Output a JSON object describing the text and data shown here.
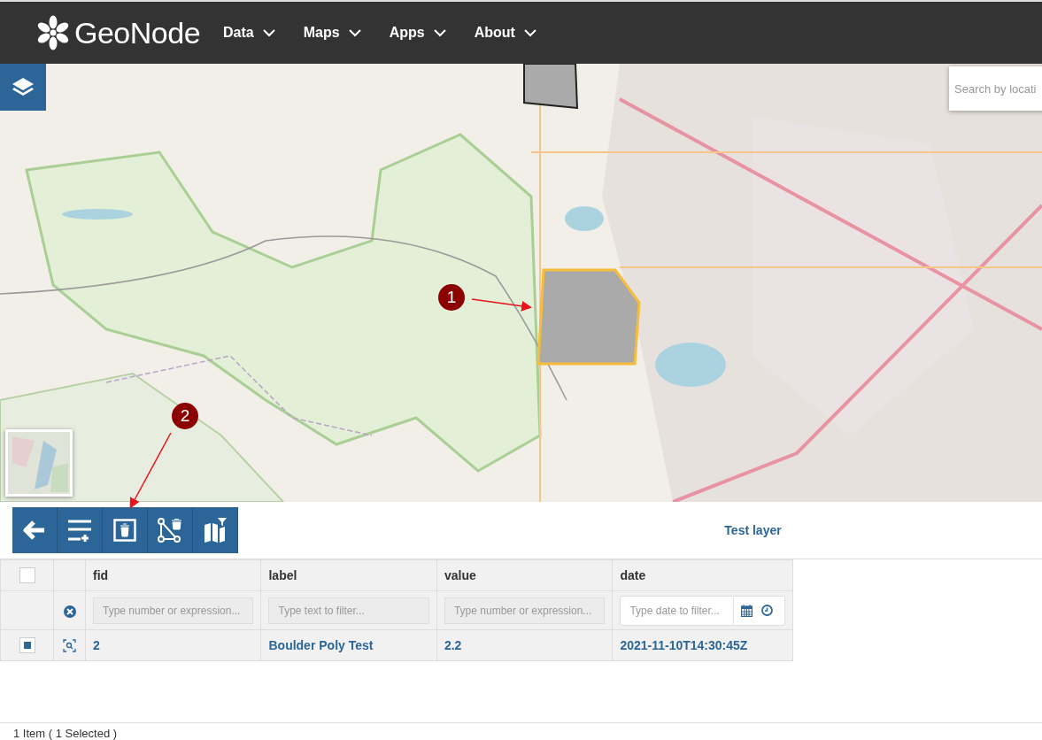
{
  "navbar": {
    "logo": "GeoNode",
    "menus": [
      {
        "label": "Data"
      },
      {
        "label": "Maps"
      },
      {
        "label": "Apps"
      },
      {
        "label": "About"
      }
    ]
  },
  "map": {
    "search": {
      "placeholder": "Search by locati"
    },
    "annotations": [
      {
        "label": "1"
      },
      {
        "label": "2"
      }
    ]
  },
  "feature_grid": {
    "title": "Test layer",
    "select_all": {
      "checked": false
    },
    "columns": [
      {
        "label": "fid",
        "kind": "text",
        "placeholder": "Type number or expression..."
      },
      {
        "label": "label",
        "kind": "text",
        "placeholder": "Type text to filter..."
      },
      {
        "label": "value",
        "kind": "text",
        "placeholder": "Type number or expression..."
      },
      {
        "label": "date",
        "kind": "date",
        "placeholder": "Type date to filter..."
      }
    ],
    "rows": [
      {
        "selected": true,
        "cells": [
          "2",
          "Boulder Poly Test",
          "2.2",
          "2021-11-10T14:30:45Z"
        ]
      }
    ]
  },
  "status_bar": "1 Item ( 1 Selected )"
}
